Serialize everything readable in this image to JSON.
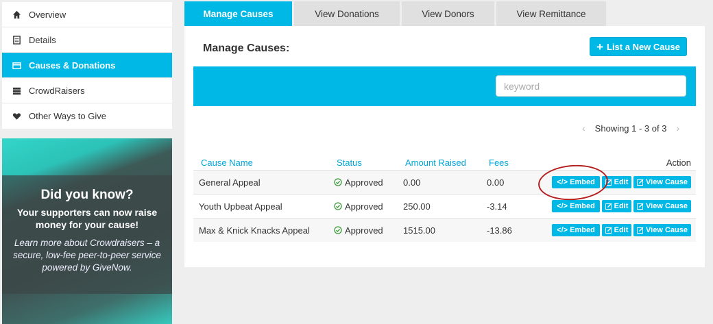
{
  "sidebar": {
    "items": [
      {
        "label": "Overview",
        "icon": "home-icon"
      },
      {
        "label": "Details",
        "icon": "document-icon"
      },
      {
        "label": "Causes & Donations",
        "icon": "card-icon",
        "active": true
      },
      {
        "label": "CrowdRaisers",
        "icon": "server-icon"
      },
      {
        "label": "Other Ways to Give",
        "icon": "heart-icon"
      }
    ]
  },
  "promo": {
    "heading": "Did you know?",
    "lead": "Your supporters can now raise money for your cause!",
    "sub": "Learn more about Crowdraisers – a secure, low-fee peer-to-peer service powered by GiveNow."
  },
  "tabs": [
    {
      "label": "Manage Causes",
      "active": true
    },
    {
      "label": "View Donations"
    },
    {
      "label": "View Donors"
    },
    {
      "label": "View Remittance"
    }
  ],
  "main": {
    "title": "Manage Causes:",
    "new_button": "List a New Cause",
    "search_placeholder": "keyword",
    "pager_text": "Showing 1 - 3 of 3"
  },
  "table": {
    "headers": {
      "name": "Cause Name",
      "status": "Status",
      "amount": "Amount Raised",
      "fees": "Fees",
      "action": "Action"
    },
    "rows": [
      {
        "name": "General Appeal",
        "status": "Approved",
        "amount": "0.00",
        "fees": "0.00"
      },
      {
        "name": "Youth Upbeat Appeal",
        "status": "Approved",
        "amount": "250.00",
        "fees": "-3.14"
      },
      {
        "name": "Max & Knick Knacks Appeal",
        "status": "Approved",
        "amount": "1515.00",
        "fees": "-13.86"
      }
    ],
    "actions": {
      "embed": "</> Embed",
      "edit": "Edit",
      "view": "View Cause"
    }
  },
  "colors": {
    "accent": "#00b8e6",
    "highlight_circle": "#b3201f",
    "approved": "#3a9a3a"
  }
}
